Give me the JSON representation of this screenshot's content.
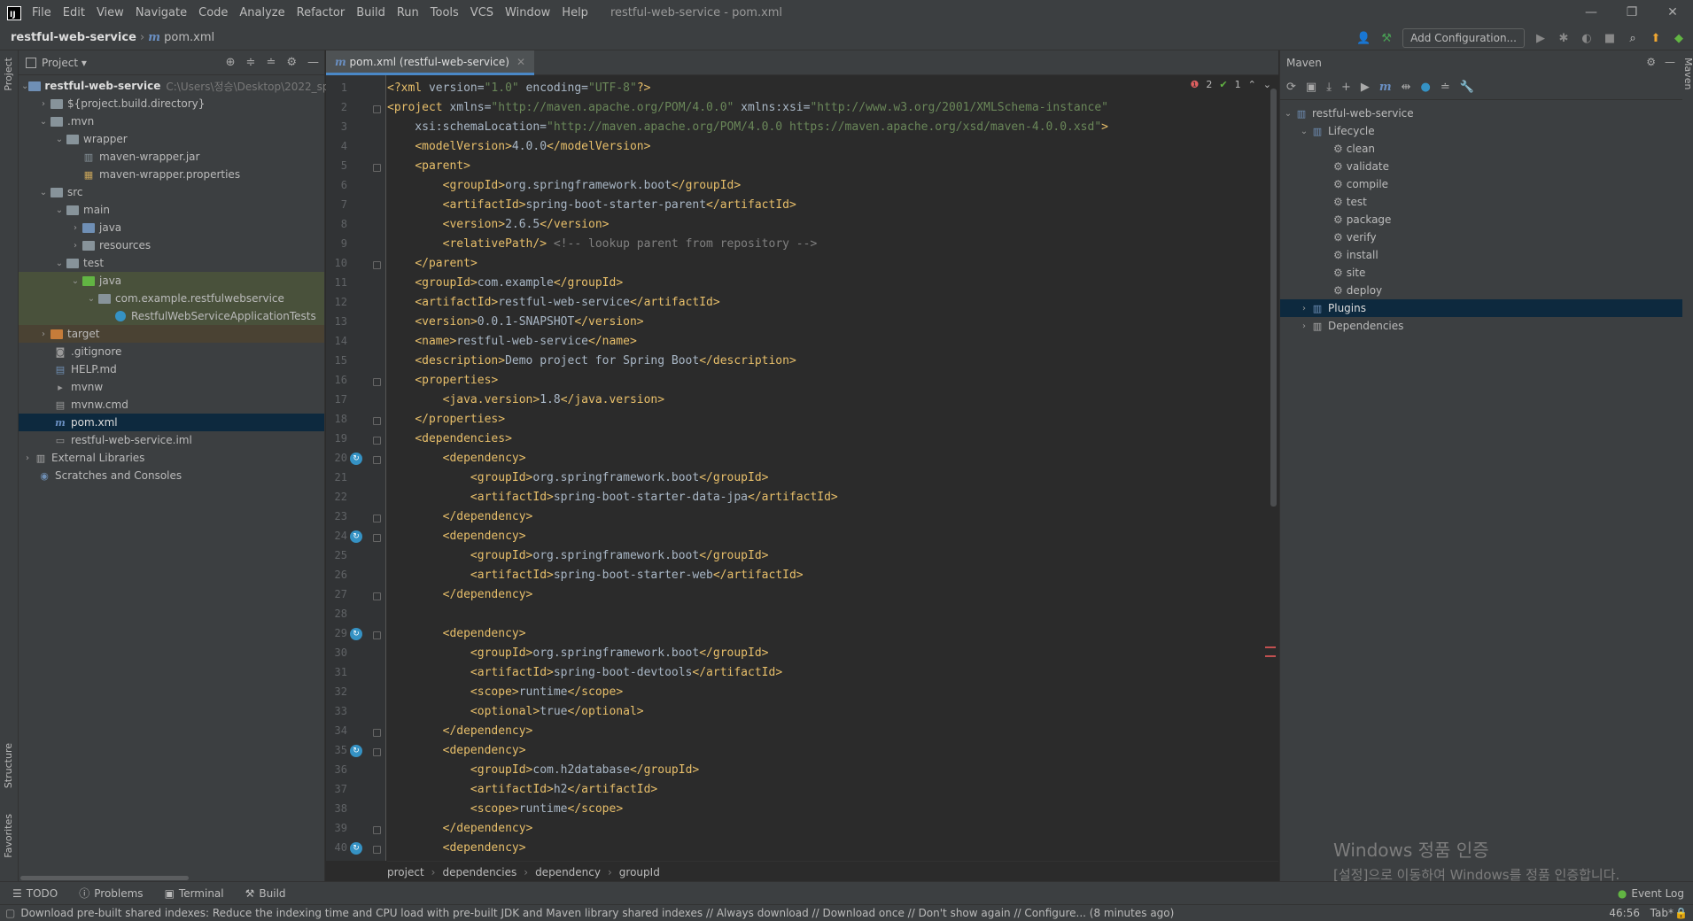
{
  "app": {
    "title": "restful-web-service - pom.xml",
    "menu": [
      "File",
      "Edit",
      "View",
      "Navigate",
      "Code",
      "Analyze",
      "Refactor",
      "Build",
      "Run",
      "Tools",
      "VCS",
      "Window",
      "Help"
    ],
    "logo_letters": "IJ"
  },
  "navbar": {
    "project": "restful-web-service",
    "file": "pom.xml",
    "add_configuration": "Add Configuration..."
  },
  "project_panel": {
    "title": "Project",
    "root_name": "restful-web-service",
    "root_path": "C:\\Users\\정승\\Desktop\\2022_sp",
    "nodes": [
      {
        "label": "${project.build.directory}"
      },
      {
        "label": ".mvn"
      },
      {
        "label": "wrapper"
      },
      {
        "label": "maven-wrapper.jar"
      },
      {
        "label": "maven-wrapper.properties"
      },
      {
        "label": "src"
      },
      {
        "label": "main"
      },
      {
        "label": "java"
      },
      {
        "label": "resources"
      },
      {
        "label": "test"
      },
      {
        "label": "java"
      },
      {
        "label": "com.example.restfulwebservice"
      },
      {
        "label": "RestfulWebServiceApplicationTests"
      },
      {
        "label": "target"
      },
      {
        "label": ".gitignore"
      },
      {
        "label": "HELP.md"
      },
      {
        "label": "mvnw"
      },
      {
        "label": "mvnw.cmd"
      },
      {
        "label": "pom.xml"
      },
      {
        "label": "restful-web-service.iml"
      },
      {
        "label": "External Libraries"
      },
      {
        "label": "Scratches and Consoles"
      }
    ]
  },
  "editor": {
    "tab_label": "pom.xml (restful-web-service)",
    "errors": "2",
    "warnings": "1",
    "line_numbers": [
      "1",
      "2",
      "3",
      "4",
      "5",
      "6",
      "7",
      "8",
      "9",
      "10",
      "11",
      "12",
      "13",
      "14",
      "15",
      "16",
      "17",
      "18",
      "19",
      "20",
      "21",
      "22",
      "23",
      "24",
      "25",
      "26",
      "27",
      "28",
      "29",
      "30",
      "31",
      "32",
      "33",
      "34",
      "35",
      "36",
      "37",
      "38",
      "39",
      "40"
    ]
  },
  "code_lines": [
    "<?xml version=\"1.0\" encoding=\"UTF-8\"?>",
    "<project xmlns=\"http://maven.apache.org/POM/4.0.0\" xmlns:xsi=\"http://www.w3.org/2001/XMLSchema-instance\"",
    "    xsi:schemaLocation=\"http://maven.apache.org/POM/4.0.0 https://maven.apache.org/xsd/maven-4.0.0.xsd\">",
    "    <modelVersion>4.0.0</modelVersion>",
    "    <parent>",
    "        <groupId>org.springframework.boot</groupId>",
    "        <artifactId>spring-boot-starter-parent</artifactId>",
    "        <version>2.6.5</version>",
    "        <relativePath/> <!-- lookup parent from repository -->",
    "    </parent>",
    "    <groupId>com.example</groupId>",
    "    <artifactId>restful-web-service</artifactId>",
    "    <version>0.0.1-SNAPSHOT</version>",
    "    <name>restful-web-service</name>",
    "    <description>Demo project for Spring Boot</description>",
    "    <properties>",
    "        <java.version>1.8</java.version>",
    "    </properties>",
    "    <dependencies>",
    "        <dependency>",
    "            <groupId>org.springframework.boot</groupId>",
    "            <artifactId>spring-boot-starter-data-jpa</artifactId>",
    "        </dependency>",
    "        <dependency>",
    "            <groupId>org.springframework.boot</groupId>",
    "            <artifactId>spring-boot-starter-web</artifactId>",
    "        </dependency>",
    "",
    "        <dependency>",
    "            <groupId>org.springframework.boot</groupId>",
    "            <artifactId>spring-boot-devtools</artifactId>",
    "            <scope>runtime</scope>",
    "            <optional>true</optional>",
    "        </dependency>",
    "        <dependency>",
    "            <groupId>com.h2database</groupId>",
    "            <artifactId>h2</artifactId>",
    "            <scope>runtime</scope>",
    "        </dependency>",
    "        <dependency>"
  ],
  "breadcrumb": [
    "project",
    "dependencies",
    "dependency",
    "groupId"
  ],
  "maven": {
    "title": "Maven",
    "root": "restful-web-service",
    "lifecycle_label": "Lifecycle",
    "lifecycle": [
      "clean",
      "validate",
      "compile",
      "test",
      "package",
      "verify",
      "install",
      "site",
      "deploy"
    ],
    "plugins_label": "Plugins",
    "dependencies_label": "Dependencies"
  },
  "watermark": {
    "line1": "Windows 정품 인증",
    "line2": "[설정]으로 이동하여 Windows를 정품 인증합니다."
  },
  "toolwindows": [
    "TODO",
    "Problems",
    "Terminal",
    "Build"
  ],
  "event_log": "Event Log",
  "status": {
    "message": "Download pre-built shared indexes: Reduce the indexing time and CPU load with pre-built JDK and Maven library shared indexes // Always download // Download once // Don't show again // Configure... (8 minutes ago)",
    "position": "46:56",
    "indent": "Tab*"
  },
  "stripes": {
    "left_top": "Project",
    "left_structure": "Structure",
    "left_favorites": "Favorites",
    "right": "Maven"
  }
}
